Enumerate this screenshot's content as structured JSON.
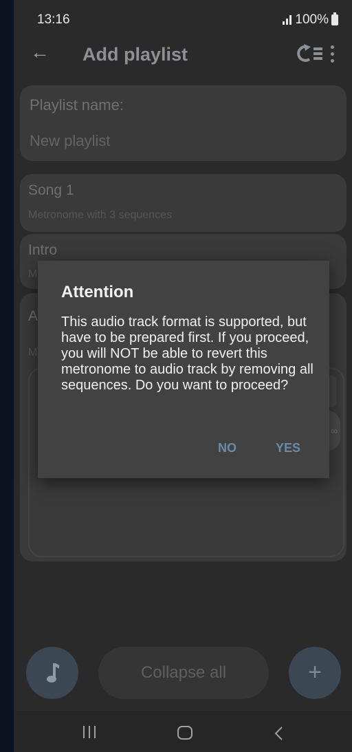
{
  "status_bar": {
    "time": "13:16",
    "battery_text": "100%"
  },
  "app_bar": {
    "title": "Add playlist"
  },
  "playlist": {
    "label": "Playlist name:",
    "value": "New playlist"
  },
  "songs": [
    {
      "title": "Song 1",
      "subtitle": "Metronome with 3 sequences"
    },
    {
      "title": "Intro",
      "subtitle": "M"
    },
    {
      "title": "A",
      "subtitle": "M"
    }
  ],
  "inner_badge": "∞",
  "bottom": {
    "collapse_label": "Collapse all",
    "add_label": "+"
  },
  "dialog": {
    "title": "Attention",
    "message": "This audio track format is supported, but have to be prepared first. If you proceed, you will NOT be able to revert this metronome to audio track by removing all sequences. Do you want to proceed?",
    "no_label": "NO",
    "yes_label": "YES"
  },
  "colors": {
    "dialog_bg": "#424242",
    "accent": "#6b8aa6",
    "fab_bg": "#3b4753"
  }
}
